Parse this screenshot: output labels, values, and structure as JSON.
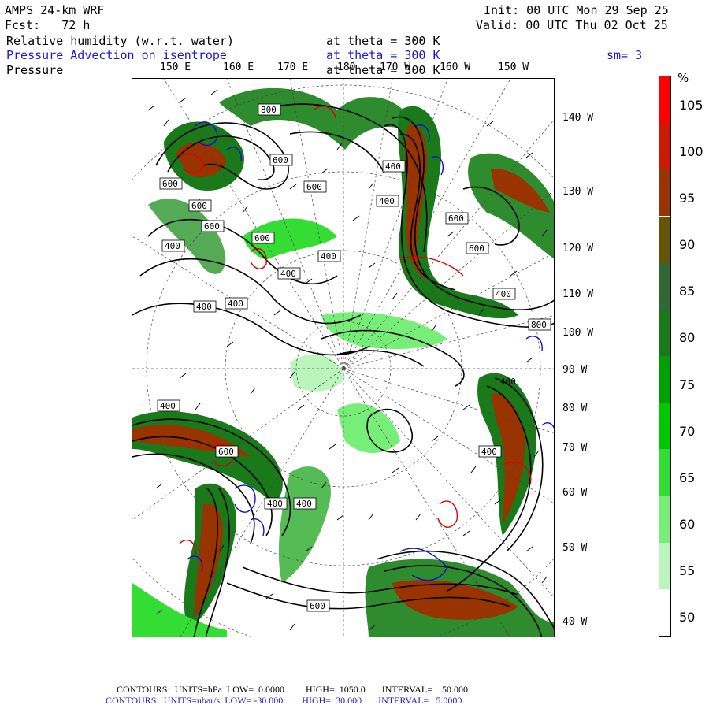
{
  "header": {
    "model": "AMPS 24-km WRF",
    "fcst": "Fcst:   72 h",
    "init": "Init: 00 UTC Mon 29 Sep 25",
    "valid": "Valid: 00 UTC Thu 02 Oct 25",
    "field1": "Relative humidity (w.r.t. water)",
    "field1_level": "at theta = 300 K",
    "field2": "Pressure Advection on isentrope",
    "field2_level": "at theta = 300 K",
    "smooth": "sm= 3",
    "field3": "Pressure",
    "field3_level": "at theta = 300 K"
  },
  "map": {
    "lon_top": [
      "150 E",
      "160 E",
      "170 E",
      "180",
      "170 W",
      "160 W",
      "150 W"
    ],
    "lon_right": [
      "140 W",
      "130 W",
      "120 W",
      "110 W",
      "100 W",
      "90 W",
      "80 W",
      "70 W",
      "60 W",
      "50 W",
      "40 W"
    ],
    "contour_labels": [
      "800",
      "600",
      "600",
      "600",
      "600",
      "600",
      "600",
      "400",
      "400",
      "400",
      "400",
      "400",
      "400",
      "400",
      "400",
      "400",
      "400",
      "400",
      "600",
      "600",
      "600",
      "800",
      "600",
      "400",
      "400"
    ]
  },
  "colorbar": {
    "unit": "%",
    "labels": [
      "105",
      "100",
      "95",
      "90",
      "85",
      "80",
      "75",
      "70",
      "65",
      "60",
      "55",
      "50"
    ],
    "colors": [
      "#ff0000",
      "#cc1a00",
      "#993300",
      "#665500",
      "#336633",
      "#1a7a1a",
      "#00a000",
      "#00c800",
      "#33dd33",
      "#77ee77",
      "#bbf5bb",
      "#ffffff"
    ]
  },
  "footer": {
    "line1": "CONTOURS:  UNITS=hPa  LOW=  0.0000         HIGH=  1050.0       INTERVAL=    50.000",
    "line2": "CONTOURS:  UNITS=ubar/s  LOW= -30.000        HIGH=  30.000       INTERVAL=   5.0000"
  }
}
